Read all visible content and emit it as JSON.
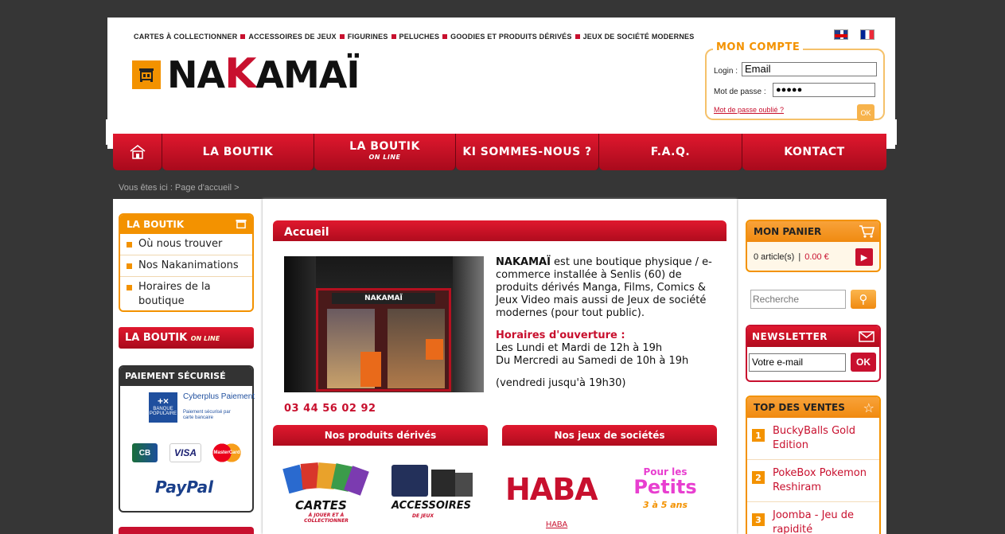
{
  "topcats": [
    "CARTES À COLLECTIONNER",
    "ACCESSOIRES DE JEUX",
    "FIGURINES",
    "PELUCHES",
    "GOODIES ET PRODUITS DÉRIVÉS",
    "JEUX DE SOCIÉTÉ MODERNES"
  ],
  "logo": {
    "pre": "NA",
    "k": "K",
    "post": "AMAÏ"
  },
  "account": {
    "title": "MON COMPTE",
    "login_label": "Login :",
    "login_value": "Email",
    "password_label": "Mot de passe :",
    "password_value": "●●●●●",
    "forgot": "Mot de passe oublié ?",
    "ok": "OK"
  },
  "nav": [
    "LA BOUTIK",
    "LA BOUTIK ON LINE",
    "KI SOMMES-NOUS ?",
    "F.A.Q.",
    "KONTACT"
  ],
  "nav_online_sub": "ON LINE",
  "breadcrumb": "Vous êtes ici : Page d'accueil >",
  "left": {
    "boutik_title": "LA BOUTIK",
    "links": [
      "Où nous trouver",
      "Nos Nakanimations",
      "Horaires de la boutique"
    ],
    "online": "LA BOUTIK",
    "online_sub": "ON LINE",
    "paiement_title": "PAIEMENT SÉCURISÉ",
    "cyberplus": "Cyberplus Paiement",
    "cyberplus_sub": "Paiement sécurisé par carte bancaire",
    "banque": "BANQUE POPULAIRE",
    "cards": [
      "CB",
      "VISA",
      "MasterCard"
    ],
    "paypal": "PayPal"
  },
  "center": {
    "title": "Accueil",
    "shop_sign": "NAKAMAÏ",
    "desc_brand": "NAKAMAÏ",
    "desc_text": " est une boutique physique / e-commerce installée à Senlis (60) de produits dérivés Manga, Films, Comics & Jeux Video mais aussi de Jeux de société modernes (pour tout public).",
    "hours_title": "Horaires d'ouverture :",
    "hours1": "Les Lundi et Mardi de 12h à 19h",
    "hours2": "Du Mercredi au Samedi de 10h à 19h",
    "hours3": "(vendredi jusqu'à 19h30)",
    "phone": "03 44 56 02 92",
    "section1": "Nos produits dérivés",
    "section2": "Nos jeux de sociétés",
    "prod1": "CARTES",
    "prod1_sub": "À JOUER ET À COLLECTIONNER",
    "prod2": "ACCESSOIRES",
    "prod2_sub": "DE JEUX",
    "haba": "HABA",
    "haba_link": "HABA",
    "petits1": "Pour les",
    "petits2": "Petits",
    "petits_age": "3 à 5 ans"
  },
  "right": {
    "panier_title": "MON PANIER",
    "panier_count": "0 article(s)",
    "panier_sep": "|",
    "panier_total": "0.00 €",
    "search_placeholder": "Recherche",
    "newsletter_title": "NEWSLETTER",
    "newsletter_value": "Votre e-mail",
    "newsletter_ok": "OK",
    "top_title": "TOP DES VENTES",
    "top": [
      {
        "n": "1",
        "name": "BuckyBalls Gold Edition"
      },
      {
        "n": "2",
        "name": "PokeBox Pokemon Reshiram"
      },
      {
        "n": "3",
        "name": "Joomba - Jeu de rapidité"
      }
    ]
  },
  "colors": {
    "brand_red": "#c8102e",
    "brand_orange": "#f39200",
    "background": "#363636"
  }
}
